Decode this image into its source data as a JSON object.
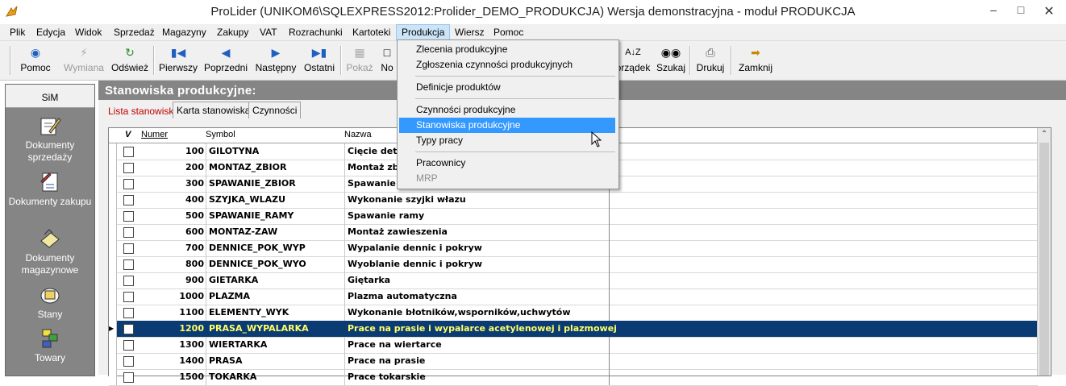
{
  "window": {
    "title": "ProLider  (UNIKOM6\\SQLEXPRESS2012:Prolider_DEMO_PRODUKCJA) Wersja demonstracyjna - moduł PRODUKCJA",
    "minimize": "–",
    "maximize": "□",
    "close": "✕"
  },
  "menubar": [
    "Plik",
    "Edycja",
    "Widok",
    "Sprzedaż",
    "Magazyny",
    "Zakupy",
    "VAT",
    "Rozrachunki",
    "Kartoteki",
    "Produkcja",
    "Wiersz",
    "Pomoc"
  ],
  "toolbar": {
    "pomoc": "Pomoc",
    "wymiana": "Wymiana",
    "odswiez": "Odśwież",
    "pierwszy": "Pierwszy",
    "poprzedni": "Poprzedni",
    "nastepny": "Następny",
    "ostatni": "Ostatni",
    "pokaz": "Pokaż",
    "nowy": "No",
    "porzadek": "orządek",
    "szukaj": "Szukaj",
    "drukuj": "Drukuj",
    "zamknij": "Zamknij"
  },
  "sidebar": {
    "header": "SiM",
    "items": [
      {
        "label": "Dokumenty sprzedaży",
        "icon": "pen-document-icon"
      },
      {
        "label": "Dokumenty zakupu",
        "icon": "purchase-document-icon"
      },
      {
        "label": "Dokumenty magazynowe",
        "icon": "warehouse-document-icon"
      },
      {
        "label": "Stany",
        "icon": "stock-icon"
      },
      {
        "label": "Towary",
        "icon": "goods-icon"
      }
    ]
  },
  "section": {
    "title": "Stanowiska produkcyjne:"
  },
  "tabs": [
    {
      "label": "Lista stanowisk"
    },
    {
      "label": "Karta stanowiska"
    },
    {
      "label": "Czynności"
    }
  ],
  "grid": {
    "columns": {
      "check": "V",
      "numer": "Numer",
      "symbol": "Symbol",
      "nazwa": "Nazwa"
    },
    "rows": [
      {
        "numer": "100",
        "symbol": "GILOTYNA",
        "nazwa": "Cięcie deta"
      },
      {
        "numer": "200",
        "symbol": "MONTAZ_ZBIOR",
        "nazwa": "Montaż zbi"
      },
      {
        "numer": "300",
        "symbol": "SPAWANIE_ZBIOR",
        "nazwa": "Spawanie z"
      },
      {
        "numer": "400",
        "symbol": "SZYJKA_WLAZU",
        "nazwa": "Wykonanie szyjki włazu"
      },
      {
        "numer": "500",
        "symbol": "SPAWANIE_RAMY",
        "nazwa": "Spawanie ramy"
      },
      {
        "numer": "600",
        "symbol": "MONTAZ-ZAW",
        "nazwa": "Montaż zawieszenia"
      },
      {
        "numer": "700",
        "symbol": "DENNICE_POK_WYP",
        "nazwa": "Wypalanie dennic i pokryw"
      },
      {
        "numer": "800",
        "symbol": "DENNICE_POK_WYO",
        "nazwa": "Wyoblanie dennic i pokryw"
      },
      {
        "numer": "900",
        "symbol": "GIETARKA",
        "nazwa": "Giętarka"
      },
      {
        "numer": "1000",
        "symbol": "PLAZMA",
        "nazwa": "Plazma automatyczna"
      },
      {
        "numer": "1100",
        "symbol": "ELEMENTY_WYK",
        "nazwa": "Wykonanie błotników,wsporników,uchwytów"
      },
      {
        "numer": "1200",
        "symbol": "PRASA_WYPALARKA",
        "nazwa": "Prace na prasie i wypalarce acetylenowej i plazmowej"
      },
      {
        "numer": "1300",
        "symbol": "WIERTARKA",
        "nazwa": "Prace na wiertarce"
      },
      {
        "numer": "1400",
        "symbol": "PRASA",
        "nazwa": "Prace na prasie"
      },
      {
        "numer": "1500",
        "symbol": "TOKARKA",
        "nazwa": "Prace tokarskie"
      }
    ]
  },
  "dropdown": {
    "items": [
      "Zlecenia produkcyjne",
      "Zgłoszenia czynności produkcyjnych",
      "Definicje produktów",
      "Czynności produkcyjne",
      "Stanowiska produkcyjne",
      "Typy pracy",
      "Pracownicy",
      "MRP"
    ]
  },
  "colors": {
    "selected_row_bg": "#0b3b73",
    "selected_row_text": "#ffff66",
    "menu_hover": "#3399ff",
    "panel_gray": "#858585"
  }
}
